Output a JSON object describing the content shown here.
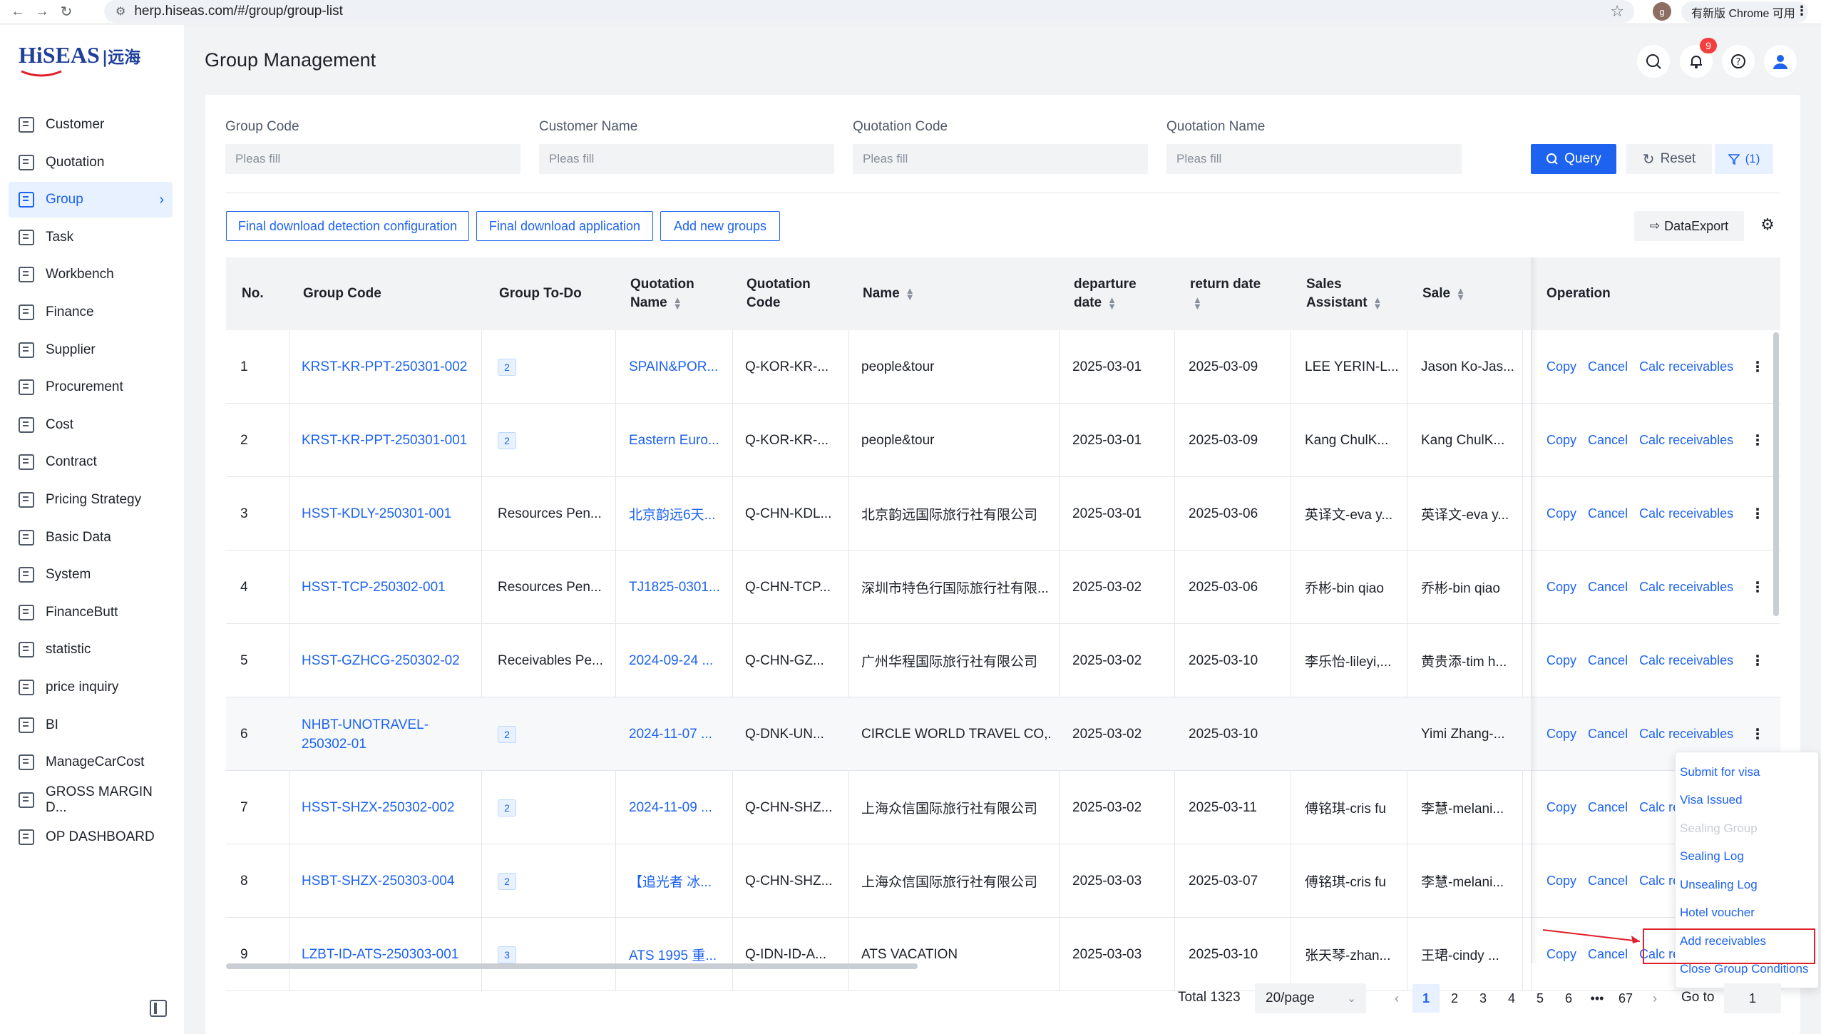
{
  "browser": {
    "url": "herp.hiseas.com/#/group/group-list",
    "profile_initial": "g",
    "update_label": "有新版 Chrome 可用"
  },
  "logo": {
    "brand": "HiSEAS",
    "brand_cn": "|远海"
  },
  "sidebar": {
    "items": [
      {
        "label": "Customer",
        "icon": "customer-icon"
      },
      {
        "label": "Quotation",
        "icon": "quotation-icon"
      },
      {
        "label": "Group",
        "icon": "group-icon"
      },
      {
        "label": "Task",
        "icon": "task-icon"
      },
      {
        "label": "Workbench",
        "icon": "workbench-icon"
      },
      {
        "label": "Finance",
        "icon": "finance-icon"
      },
      {
        "label": "Supplier",
        "icon": "supplier-icon"
      },
      {
        "label": "Procurement",
        "icon": "procurement-icon"
      },
      {
        "label": "Cost",
        "icon": "cost-icon"
      },
      {
        "label": "Contract",
        "icon": "contract-icon"
      },
      {
        "label": "Pricing Strategy",
        "icon": "pricing-icon"
      },
      {
        "label": "Basic Data",
        "icon": "basic-data-icon"
      },
      {
        "label": "System",
        "icon": "system-icon"
      },
      {
        "label": "FinanceButt",
        "icon": "finance-butt-icon"
      },
      {
        "label": "statistic",
        "icon": "statistic-icon"
      },
      {
        "label": "price inquiry",
        "icon": "price-inquiry-icon"
      },
      {
        "label": "BI",
        "icon": "bi-icon"
      },
      {
        "label": "ManageCarCost",
        "icon": "car-cost-icon"
      },
      {
        "label": "GROSS MARGIN D...",
        "icon": "gross-margin-icon"
      },
      {
        "label": "OP DASHBOARD",
        "icon": "op-dashboard-icon"
      }
    ],
    "active": "Group"
  },
  "header": {
    "title": "Group Management",
    "notification_count": "9"
  },
  "filters": {
    "fields": [
      {
        "label": "Group Code",
        "placeholder": "Pleas fill"
      },
      {
        "label": "Customer Name",
        "placeholder": "Pleas fill"
      },
      {
        "label": "Quotation Code",
        "placeholder": "Pleas fill"
      },
      {
        "label": "Quotation Name",
        "placeholder": "Pleas fill"
      }
    ],
    "query_label": "Query",
    "reset_label": "Reset",
    "filter_count_label": "(1)"
  },
  "actions": {
    "detection_config": "Final download detection configuration",
    "download_application": "Final download application",
    "add_groups": "Add new groups",
    "data_export": "DataExport"
  },
  "table": {
    "headers": {
      "no": "No.",
      "group_code": "Group Code",
      "group_todo": "Group To-Do",
      "quotation_name_1": "Quotation",
      "quotation_name_2": "Name",
      "quotation_code_1": "Quotation",
      "quotation_code_2": "Code",
      "name": "Name",
      "departure_1": "departure",
      "departure_2": "date",
      "return_1": "return date",
      "sales_assistant_1": "Sales",
      "sales_assistant_2": "Assistant",
      "sale": "Sale",
      "operation": "Operation"
    },
    "op_labels": {
      "copy": "Copy",
      "cancel": "Cancel",
      "calc": "Calc receivables",
      "calc_cut": "Calc re"
    },
    "rows": [
      {
        "no": "1",
        "group_code": "KRST-KR-PPT-250301-002",
        "todo": "",
        "todo_badge": "2",
        "quotation_name": "SPAIN&POR...",
        "quotation_code": "Q-KOR-KR-...",
        "name": "people&tour",
        "departure": "2025-03-01",
        "return": "2025-03-09",
        "sales_assistant": "LEE YERIN-L...",
        "sale": "Jason Ko-Jas..."
      },
      {
        "no": "2",
        "group_code": "KRST-KR-PPT-250301-001",
        "todo": "",
        "todo_badge": "2",
        "quotation_name": "Eastern Euro...",
        "quotation_code": "Q-KOR-KR-...",
        "name": "people&tour",
        "departure": "2025-03-01",
        "return": "2025-03-09",
        "sales_assistant": "Kang ChulK...",
        "sale": "Kang ChulK..."
      },
      {
        "no": "3",
        "group_code": "HSST-KDLY-250301-001",
        "todo": "Resources Pen...",
        "todo_badge": "",
        "quotation_name": "北京韵远6天...",
        "quotation_code": "Q-CHN-KDL...",
        "name": "北京韵远国际旅行社有限公司",
        "departure": "2025-03-01",
        "return": "2025-03-06",
        "sales_assistant": "英译文-eva y...",
        "sale": "英译文-eva y..."
      },
      {
        "no": "4",
        "group_code": "HSST-TCP-250302-001",
        "todo": "Resources Pen...",
        "todo_badge": "",
        "quotation_name": "TJ1825-0301...",
        "quotation_code": "Q-CHN-TCP...",
        "name": "深圳市特色行国际旅行社有限...",
        "departure": "2025-03-02",
        "return": "2025-03-06",
        "sales_assistant": "乔彬-bin qiao",
        "sale": "乔彬-bin qiao"
      },
      {
        "no": "5",
        "group_code": "HSST-GZHCG-250302-02",
        "todo": "Receivables Pe...",
        "todo_badge": "",
        "quotation_name": "2024-09-24 ...",
        "quotation_code": "Q-CHN-GZ...",
        "name": "广州华程国际旅行社有限公司",
        "departure": "2025-03-02",
        "return": "2025-03-10",
        "sales_assistant": "李乐怡-lileyi,...",
        "sale": "黄贵添-tim h..."
      },
      {
        "no": "6",
        "group_code": "NHBT-UNOTRAVEL-250302-01",
        "todo": "",
        "todo_badge": "2",
        "quotation_name": "2024-11-07 ...",
        "quotation_code": "Q-DNK-UN...",
        "name": "CIRCLE WORLD TRAVEL CO,...",
        "departure": "2025-03-02",
        "return": "2025-03-10",
        "sales_assistant": "",
        "sale": "Yimi Zhang-..."
      },
      {
        "no": "7",
        "group_code": "HSST-SHZX-250302-002",
        "todo": "",
        "todo_badge": "2",
        "quotation_name": "2024-11-09 ...",
        "quotation_code": "Q-CHN-SHZ...",
        "name": "上海众信国际旅行社有限公司",
        "departure": "2025-03-02",
        "return": "2025-03-11",
        "sales_assistant": "傅铭琪-cris fu",
        "sale": "李慧-melani..."
      },
      {
        "no": "8",
        "group_code": "HSBT-SHZX-250303-004",
        "todo": "",
        "todo_badge": "2",
        "quotation_name": "【追光者 冰...",
        "quotation_code": "Q-CHN-SHZ...",
        "name": "上海众信国际旅行社有限公司",
        "departure": "2025-03-03",
        "return": "2025-03-07",
        "sales_assistant": "傅铭琪-cris fu",
        "sale": "李慧-melani..."
      },
      {
        "no": "9",
        "group_code": "LZBT-ID-ATS-250303-001",
        "todo": "",
        "todo_badge": "3",
        "quotation_name": "ATS 1995 重...",
        "quotation_code": "Q-IDN-ID-A...",
        "name": "ATS VACATION",
        "departure": "2025-03-03",
        "return": "2025-03-10",
        "sales_assistant": "张天琴-zhan...",
        "sale": "王珺-cindy ..."
      }
    ]
  },
  "dropdown": {
    "items": [
      {
        "label": "Submit for visa",
        "disabled": false
      },
      {
        "label": "Visa Issued",
        "disabled": false
      },
      {
        "label": "Sealing Group",
        "disabled": true
      },
      {
        "label": "Sealing Log",
        "disabled": false
      },
      {
        "label": "Unsealing Log",
        "disabled": false
      },
      {
        "label": "Hotel voucher",
        "disabled": false
      },
      {
        "label": "Add receivables",
        "disabled": false
      },
      {
        "label": "Close Group Conditions",
        "disabled": false
      }
    ]
  },
  "pagination": {
    "total_label": "Total 1323",
    "page_size": "20/page",
    "pages": [
      "1",
      "2",
      "3",
      "4",
      "5",
      "6",
      "•••",
      "67"
    ],
    "current_page": "1",
    "goto_label": "Go to",
    "goto_value": "1"
  },
  "colors": {
    "primary": "#1d63f0",
    "danger": "#e0202a",
    "disabled": "#c9cdd4"
  }
}
